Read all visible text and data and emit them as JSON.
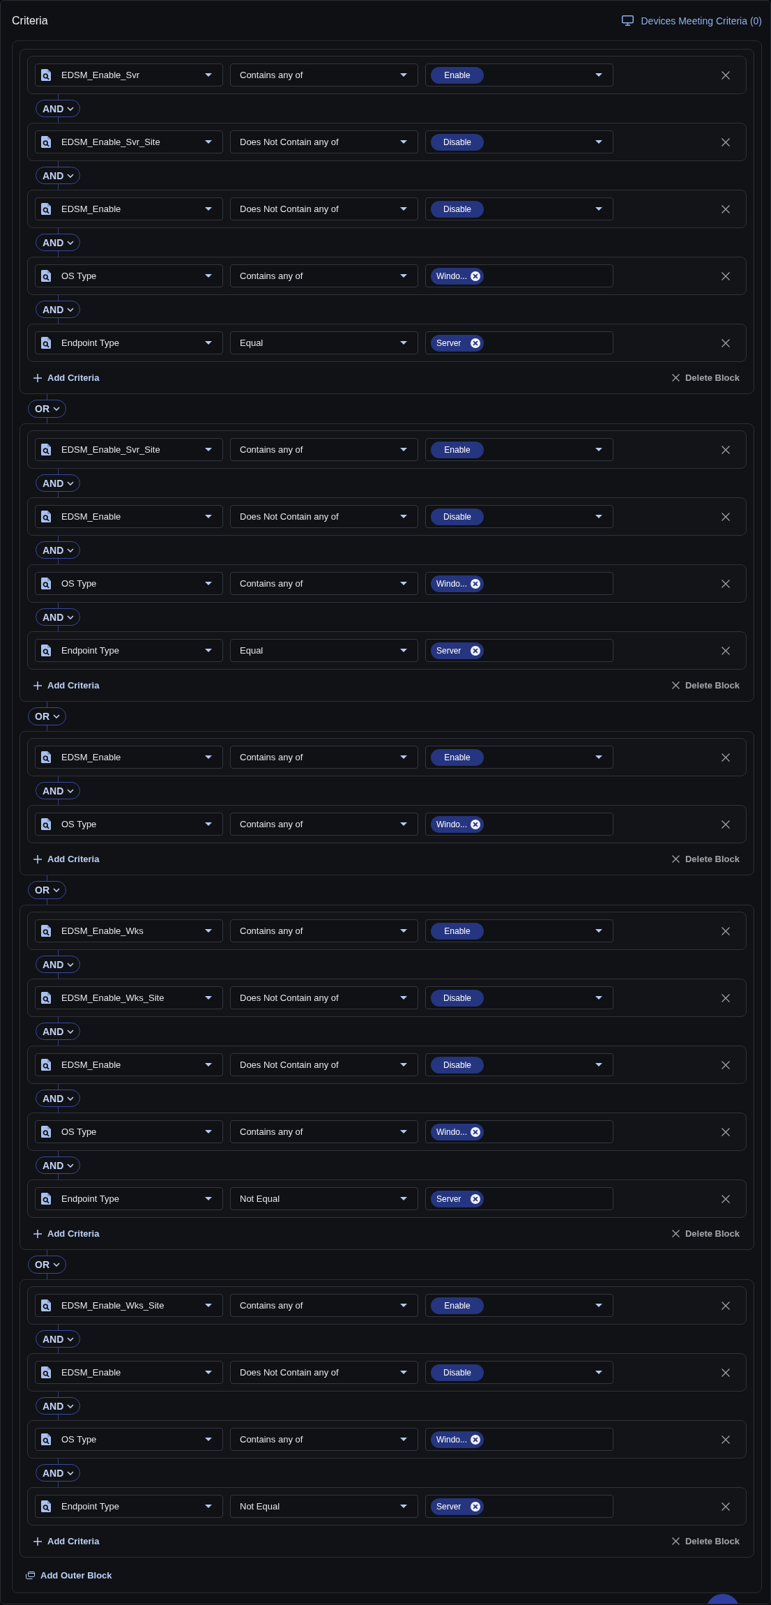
{
  "header": {
    "title": "Criteria",
    "devices_link": "Devices Meeting Criteria (0)"
  },
  "blocks": [
    {
      "criteria": [
        {
          "field": "EDSM_Enable_Svr",
          "operator": "Contains any of",
          "kind": "single",
          "values": [
            "Enable"
          ]
        },
        {
          "connector": "AND",
          "field": "EDSM_Enable_Svr_Site",
          "operator": "Does Not Contain any of",
          "kind": "single",
          "values": [
            "Disable"
          ]
        },
        {
          "connector": "AND",
          "field": "EDSM_Enable",
          "operator": "Does Not Contain any of",
          "kind": "single",
          "values": [
            "Disable"
          ]
        },
        {
          "connector": "AND",
          "field": "OS Type",
          "operator": "Contains any of",
          "kind": "multi",
          "values": [
            "Windo..."
          ]
        },
        {
          "connector": "AND",
          "field": "Endpoint Type",
          "operator": "Equal",
          "kind": "multi",
          "values": [
            "Server"
          ]
        }
      ],
      "add_label": "Add Criteria",
      "delete_label": "Delete Block"
    },
    {
      "connector": "OR",
      "criteria": [
        {
          "field": "EDSM_Enable_Svr_Site",
          "operator": "Contains any of",
          "kind": "single",
          "values": [
            "Enable"
          ]
        },
        {
          "connector": "AND",
          "field": "EDSM_Enable",
          "operator": "Does Not Contain any of",
          "kind": "single",
          "values": [
            "Disable"
          ]
        },
        {
          "connector": "AND",
          "field": "OS Type",
          "operator": "Contains any of",
          "kind": "multi",
          "values": [
            "Windo..."
          ]
        },
        {
          "connector": "AND",
          "field": "Endpoint Type",
          "operator": "Equal",
          "kind": "multi",
          "values": [
            "Server"
          ]
        }
      ],
      "add_label": "Add Criteria",
      "delete_label": "Delete Block"
    },
    {
      "connector": "OR",
      "criteria": [
        {
          "field": "EDSM_Enable",
          "operator": "Contains any of",
          "kind": "single",
          "values": [
            "Enable"
          ]
        },
        {
          "connector": "AND",
          "field": "OS Type",
          "operator": "Contains any of",
          "kind": "multi",
          "values": [
            "Windo..."
          ]
        }
      ],
      "add_label": "Add Criteria",
      "delete_label": "Delete Block"
    },
    {
      "connector": "OR",
      "criteria": [
        {
          "field": "EDSM_Enable_Wks",
          "operator": "Contains any of",
          "kind": "single",
          "values": [
            "Enable"
          ]
        },
        {
          "connector": "AND",
          "field": "EDSM_Enable_Wks_Site",
          "operator": "Does Not Contain any of",
          "kind": "single",
          "values": [
            "Disable"
          ]
        },
        {
          "connector": "AND",
          "field": "EDSM_Enable",
          "operator": "Does Not Contain any of",
          "kind": "single",
          "values": [
            "Disable"
          ]
        },
        {
          "connector": "AND",
          "field": "OS Type",
          "operator": "Contains any of",
          "kind": "multi",
          "values": [
            "Windo..."
          ]
        },
        {
          "connector": "AND",
          "field": "Endpoint Type",
          "operator": "Not Equal",
          "kind": "multi",
          "values": [
            "Server"
          ]
        }
      ],
      "add_label": "Add Criteria",
      "delete_label": "Delete Block"
    },
    {
      "connector": "OR",
      "criteria": [
        {
          "field": "EDSM_Enable_Wks_Site",
          "operator": "Contains any of",
          "kind": "single",
          "values": [
            "Enable"
          ]
        },
        {
          "connector": "AND",
          "field": "EDSM_Enable",
          "operator": "Does Not Contain any of",
          "kind": "single",
          "values": [
            "Disable"
          ]
        },
        {
          "connector": "AND",
          "field": "OS Type",
          "operator": "Contains any of",
          "kind": "multi",
          "values": [
            "Windo..."
          ]
        },
        {
          "connector": "AND",
          "field": "Endpoint Type",
          "operator": "Not Equal",
          "kind": "multi",
          "values": [
            "Server"
          ]
        }
      ],
      "add_label": "Add Criteria",
      "delete_label": "Delete Block"
    }
  ],
  "footer": {
    "add_outer_block": "Add Outer Block"
  }
}
